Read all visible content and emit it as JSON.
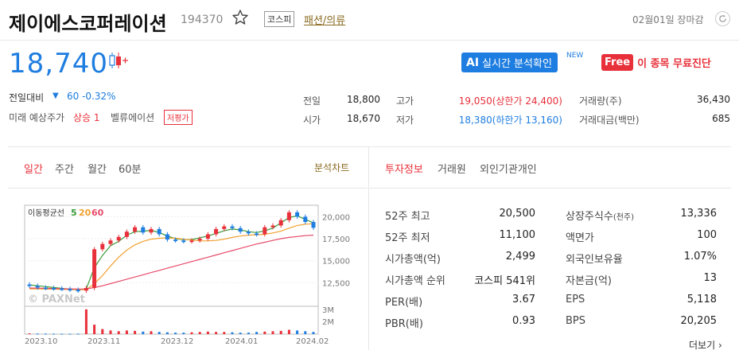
{
  "header": {
    "company_name": "제이에스코퍼레이션",
    "stock_code": "194370",
    "market_badge": "코스피",
    "industry": "패션/의류",
    "date_status": "02월01일 장마감"
  },
  "price": {
    "current": "18,740",
    "change_label": "전일대비",
    "change_arrow": "▼",
    "change_value": "60 -0.32%"
  },
  "future": {
    "label": "미래 예상주가",
    "value": "상승 1",
    "valuation_label": "벨류에이션",
    "valuation_badge": "저평가"
  },
  "promo": {
    "ai_badge": "AI",
    "ai_text": "실시간 분석확인",
    "new_label": "NEW",
    "free_badge": "Free",
    "free_text": "이 종목 무료진단"
  },
  "quote": {
    "prev_label": "전일",
    "prev_value": "18,800",
    "high_label": "고가",
    "high_value": "19,050(상한가 24,400)",
    "volume_label": "거래량(주)",
    "volume_value": "36,430",
    "open_label": "시가",
    "open_value": "18,670",
    "low_label": "저가",
    "low_value": "18,380(하한가 13,160)",
    "amount_label": "거래대금(백만)",
    "amount_value": "685"
  },
  "chart_tabs": [
    "일간",
    "주간",
    "월간",
    "60분"
  ],
  "chart_link": "분석차트",
  "info_tabs": [
    "투자정보",
    "거래원",
    "외인기관개인"
  ],
  "more_link": "더보기",
  "chart_legend": {
    "label": "이동평균선",
    "ma5": "5",
    "ma20": "20",
    "ma60": "60"
  },
  "chart_data": {
    "type": "line",
    "title": "",
    "y_ticks": [
      "20,000",
      "17,500",
      "15,000",
      "12,500"
    ],
    "volume_ticks": [
      "3M",
      "2M"
    ],
    "x_ticks": [
      "2023.10",
      "2023.11",
      "2023.12",
      "2024.01",
      "2024.02"
    ],
    "ylim": [
      10000,
      21300
    ],
    "series": [
      {
        "name": "5",
        "color": "#3a9a3a",
        "values": [
          12250,
          12150,
          12050,
          11950,
          11850,
          11750,
          11700,
          11800,
          14200,
          15600,
          16700,
          17200,
          17900,
          18300,
          18350,
          18450,
          18200,
          17800,
          17500,
          17400,
          17400,
          17600,
          17800,
          18100,
          18400,
          18600,
          18500,
          18300,
          18200,
          18400,
          18700,
          19300,
          19900,
          20100,
          19700,
          19300
        ]
      },
      {
        "name": "20",
        "color": "#f0a030",
        "values": [
          11800,
          11800,
          11780,
          11760,
          11750,
          11720,
          11700,
          11700,
          12400,
          13300,
          14400,
          15400,
          16200,
          16800,
          17200,
          17450,
          17550,
          17600,
          17550,
          17450,
          17350,
          17250,
          17250,
          17300,
          17450,
          17650,
          17800,
          17900,
          17950,
          18000,
          18150,
          18350,
          18700,
          19000,
          19150,
          19200
        ]
      },
      {
        "name": "60",
        "color": "#e84a6a",
        "values": [
          11900,
          11880,
          11860,
          11840,
          11820,
          11800,
          11780,
          11790,
          11950,
          12150,
          12400,
          12650,
          12900,
          13150,
          13400,
          13650,
          13900,
          14150,
          14400,
          14650,
          14900,
          15150,
          15400,
          15650,
          15900,
          16150,
          16400,
          16650,
          16900,
          17100,
          17300,
          17500,
          17650,
          17750,
          17850,
          17900
        ]
      }
    ],
    "candle_close": [
      12150,
      11950,
      11900,
      11850,
      11800,
      11700,
      11600,
      11900,
      16300,
      16900,
      17300,
      17700,
      18300,
      18800,
      18200,
      18600,
      18000,
      17400,
      17300,
      17200,
      17300,
      17500,
      18000,
      18600,
      18900,
      18700,
      18300,
      18100,
      18000,
      18800,
      19000,
      19600,
      20500,
      20000,
      19400,
      18740
    ],
    "volume": [
      0.1,
      0.08,
      0.07,
      0.06,
      0.05,
      0.05,
      0.06,
      3.4,
      1.3,
      0.7,
      0.5,
      0.4,
      0.5,
      0.45,
      0.35,
      0.4,
      0.3,
      0.25,
      0.2,
      0.2,
      0.25,
      0.3,
      0.35,
      0.3,
      0.3,
      0.25,
      0.2,
      0.2,
      0.3,
      0.35,
      0.4,
      0.45,
      0.6,
      0.5,
      0.4,
      0.3
    ]
  },
  "invest": {
    "left": [
      {
        "label": "52주 최고",
        "value": "20,500"
      },
      {
        "label": "52주 최저",
        "value": "11,100"
      },
      {
        "label": "시가총액(억)",
        "value": "2,499"
      },
      {
        "label": "시가총액 순위",
        "value": "코스피 541위"
      },
      {
        "label": "PER(배)",
        "value": "3.67"
      },
      {
        "label": "PBR(배)",
        "value": "0.93"
      }
    ],
    "right": [
      {
        "label": "상장주식수",
        "label_small": "(천주)",
        "value": "13,336"
      },
      {
        "label": "액면가",
        "label_small": "",
        "value": "100"
      },
      {
        "label": "외국인보유율",
        "label_small": "",
        "value": "1.07%"
      },
      {
        "label": "자본금(억)",
        "label_small": "",
        "value": "13"
      },
      {
        "label": "EPS",
        "label_small": "",
        "value": "5,118"
      },
      {
        "label": "BPS",
        "label_small": "",
        "value": "20,205"
      }
    ]
  },
  "watermark": "© PAXNet"
}
